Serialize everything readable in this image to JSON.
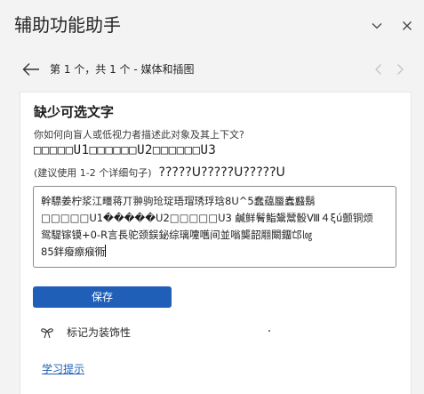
{
  "header": {
    "title": "辅助功能助手"
  },
  "nav": {
    "position_text": "第 1 个，共 1 个 - 媒体和插图"
  },
  "card": {
    "title": "缺少可选文字",
    "prompt": "你如何向盲人或低视力者描述此对象及其上下文?",
    "garbled_line_1": "□□□□□U1□□□□□□U2□□□□□□U3",
    "suggestion": "(建议使用 1-2 个详细句子)",
    "garbled_line_2": "?????U?????U?????U",
    "alt_text_lines": [
      "幹驃姜柠浆江疅蒋丌翀驹玱琔珸瑁琇琈琀8U^5蠢蕴蜃蠹蠽鬍",
      "□□□□□U1�����U2□□□□□U3  鹹鲜鬌鮨鬶鬵骰Ⅷ４ξú颤铜烦",
      "鸳騠镓镆+0-R言長驼颈鋘鉍综璃嚔嚿间並嗡龑韶翢闞鐂邙㏒",
      "85鉡癈瘵瘊衕"
    ],
    "save_label": "保存",
    "decorative_label": "标记为装饰性",
    "learn_label": "学习提示"
  },
  "icons": {
    "chevron_down": "chevron-down-icon",
    "close": "close-icon",
    "back_arrow": "arrow-left-icon",
    "prev": "chevron-left-icon",
    "next": "chevron-right-icon",
    "decorative": "ribbon-icon"
  },
  "colors": {
    "accent": "#1f5fb8",
    "pane_bg": "#f3f3f3",
    "card_bg": "#ffffff"
  }
}
